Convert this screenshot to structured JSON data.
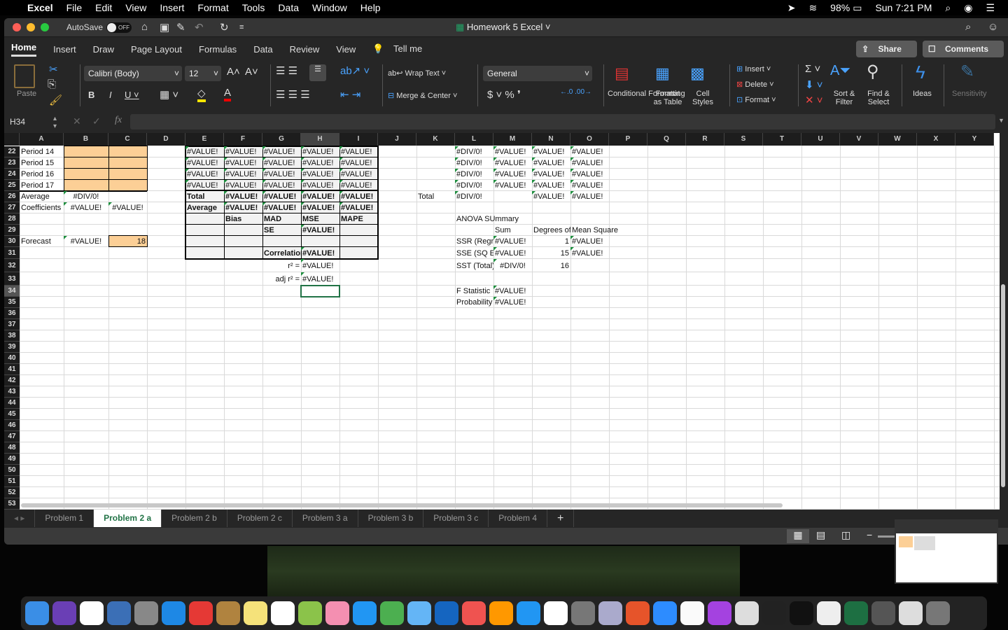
{
  "menubar": {
    "app": "Excel",
    "items": [
      "File",
      "Edit",
      "View",
      "Insert",
      "Format",
      "Tools",
      "Data",
      "Window",
      "Help"
    ],
    "battery": "98%",
    "clock": "Sun 7:21 PM"
  },
  "titlebar": {
    "autosave": "AutoSave",
    "autosave_state": "OFF",
    "title": "Homework 5 Excel"
  },
  "tabs": [
    "Home",
    "Insert",
    "Draw",
    "Page Layout",
    "Formulas",
    "Data",
    "Review",
    "View",
    "Tell me"
  ],
  "share": "Share",
  "comments": "Comments",
  "ribbon": {
    "paste": "Paste",
    "font": "Calibri (Body)",
    "size": "12",
    "wrap": "Wrap Text",
    "merge": "Merge & Center",
    "number_format": "General",
    "cond_fmt": "Conditional Formatting",
    "fmt_table": "Format as Table",
    "cell_styles": "Cell Styles",
    "insert": "Insert",
    "delete": "Delete",
    "format": "Format",
    "sort": "Sort & Filter",
    "find": "Find & Select",
    "ideas": "Ideas",
    "sensitivity": "Sensitivity"
  },
  "formula_bar": {
    "name_box": "H34",
    "fx": "fx",
    "value": ""
  },
  "grid": {
    "columns": [
      "A",
      "B",
      "C",
      "D",
      "E",
      "F",
      "G",
      "H",
      "I",
      "J",
      "K",
      "L",
      "M",
      "N",
      "O",
      "P",
      "Q",
      "R",
      "S",
      "T",
      "U",
      "V",
      "W",
      "X",
      "Y"
    ],
    "first_row": 22,
    "last_row": 53,
    "selected": "H34",
    "cells": [
      {
        "c": "A22",
        "v": "Period 14"
      },
      {
        "c": "A23",
        "v": "Period 15"
      },
      {
        "c": "A24",
        "v": "Period 16"
      },
      {
        "c": "A25",
        "v": "Period 17"
      },
      {
        "c": "A26",
        "v": "Average"
      },
      {
        "c": "B26",
        "v": "#DIV/0!",
        "a": "center",
        "f": 1
      },
      {
        "c": "A27",
        "v": "Coefficients"
      },
      {
        "c": "B27",
        "v": "#VALUE!",
        "a": "center",
        "f": 1
      },
      {
        "c": "C27",
        "v": "#VALUE!",
        "a": "center",
        "f": 1
      },
      {
        "c": "A30",
        "v": "Forecast"
      },
      {
        "c": "B30",
        "v": "#VALUE!",
        "a": "center",
        "f": 1
      },
      {
        "c": "C30",
        "v": "18",
        "a": "right"
      },
      {
        "c": "E22",
        "v": "#VALUE!",
        "f": 1
      },
      {
        "c": "F22",
        "v": "#VALUE!",
        "f": 1
      },
      {
        "c": "G22",
        "v": "#VALUE!",
        "f": 1
      },
      {
        "c": "H22",
        "v": "#VALUE!",
        "f": 1
      },
      {
        "c": "I22",
        "v": "#VALUE!",
        "f": 1
      },
      {
        "c": "E23",
        "v": "#VALUE!",
        "f": 1
      },
      {
        "c": "F23",
        "v": "#VALUE!",
        "f": 1
      },
      {
        "c": "G23",
        "v": "#VALUE!",
        "f": 1
      },
      {
        "c": "H23",
        "v": "#VALUE!",
        "f": 1
      },
      {
        "c": "I23",
        "v": "#VALUE!",
        "f": 1
      },
      {
        "c": "E24",
        "v": "#VALUE!",
        "f": 1
      },
      {
        "c": "F24",
        "v": "#VALUE!",
        "f": 1
      },
      {
        "c": "G24",
        "v": "#VALUE!",
        "f": 1
      },
      {
        "c": "H24",
        "v": "#VALUE!",
        "f": 1
      },
      {
        "c": "I24",
        "v": "#VALUE!",
        "f": 1
      },
      {
        "c": "E25",
        "v": "#VALUE!",
        "f": 1
      },
      {
        "c": "F25",
        "v": "#VALUE!",
        "f": 1
      },
      {
        "c": "G25",
        "v": "#VALUE!",
        "f": 1
      },
      {
        "c": "H25",
        "v": "#VALUE!",
        "f": 1
      },
      {
        "c": "I25",
        "v": "#VALUE!",
        "f": 1
      },
      {
        "c": "E26",
        "v": "Total",
        "b": 1
      },
      {
        "c": "F26",
        "v": "#VALUE!",
        "b": 1,
        "f": 1
      },
      {
        "c": "G26",
        "v": "#VALUE!",
        "b": 1,
        "f": 1
      },
      {
        "c": "H26",
        "v": "#VALUE!",
        "b": 1,
        "f": 1
      },
      {
        "c": "I26",
        "v": "#VALUE!",
        "b": 1,
        "f": 1
      },
      {
        "c": "E27",
        "v": "Average",
        "b": 1
      },
      {
        "c": "F27",
        "v": "#VALUE!",
        "b": 1,
        "f": 1
      },
      {
        "c": "G27",
        "v": "#VALUE!",
        "b": 1,
        "f": 1
      },
      {
        "c": "H27",
        "v": "#VALUE!",
        "b": 1,
        "f": 1
      },
      {
        "c": "I27",
        "v": "#VALUE!",
        "b": 1,
        "f": 1
      },
      {
        "c": "F28",
        "v": "Bias",
        "b": 1
      },
      {
        "c": "G28",
        "v": "MAD",
        "b": 1
      },
      {
        "c": "H28",
        "v": "MSE",
        "b": 1
      },
      {
        "c": "I28",
        "v": "MAPE",
        "b": 1
      },
      {
        "c": "G29",
        "v": "SE",
        "b": 1
      },
      {
        "c": "H29",
        "v": "#VALUE!",
        "b": 1,
        "f": 1
      },
      {
        "c": "G31",
        "v": "Correlation",
        "b": 1
      },
      {
        "c": "H31",
        "v": "#VALUE!",
        "b": 1,
        "f": 1
      },
      {
        "c": "G32",
        "v": "r² =",
        "a": "right"
      },
      {
        "c": "H32",
        "v": "#VALUE!",
        "f": 1
      },
      {
        "c": "G33",
        "v": "adj r² =",
        "a": "right"
      },
      {
        "c": "H33",
        "v": "#VALUE!",
        "f": 1
      },
      {
        "c": "K26",
        "v": "Total"
      },
      {
        "c": "L22",
        "v": "#DIV/0!",
        "f": 1
      },
      {
        "c": "M22",
        "v": "#VALUE!",
        "f": 1
      },
      {
        "c": "N22",
        "v": "#VALUE!",
        "f": 1
      },
      {
        "c": "O22",
        "v": "#VALUE!",
        "f": 1
      },
      {
        "c": "L23",
        "v": "#DIV/0!",
        "f": 1
      },
      {
        "c": "M23",
        "v": "#VALUE!",
        "f": 1
      },
      {
        "c": "N23",
        "v": "#VALUE!",
        "f": 1
      },
      {
        "c": "O23",
        "v": "#VALUE!",
        "f": 1
      },
      {
        "c": "L24",
        "v": "#DIV/0!",
        "f": 1
      },
      {
        "c": "M24",
        "v": "#VALUE!",
        "f": 1
      },
      {
        "c": "N24",
        "v": "#VALUE!",
        "f": 1
      },
      {
        "c": "O24",
        "v": "#VALUE!",
        "f": 1
      },
      {
        "c": "L25",
        "v": "#DIV/0!",
        "f": 1
      },
      {
        "c": "M25",
        "v": "#VALUE!",
        "f": 1
      },
      {
        "c": "N25",
        "v": "#VALUE!",
        "f": 1
      },
      {
        "c": "O25",
        "v": "#VALUE!",
        "f": 1
      },
      {
        "c": "L26",
        "v": "#DIV/0!",
        "f": 1
      },
      {
        "c": "N26",
        "v": "#VALUE!",
        "f": 1
      },
      {
        "c": "O26",
        "v": "#VALUE!",
        "f": 1
      },
      {
        "c": "L28",
        "v": "ANOVA SUmmary",
        "o": 1
      },
      {
        "c": "M29",
        "v": "Sum"
      },
      {
        "c": "N29",
        "v": "Degrees of"
      },
      {
        "c": "O29",
        "v": "Mean Square",
        "o": 1
      },
      {
        "c": "L30",
        "v": "SSR (Regre"
      },
      {
        "c": "M30",
        "v": "#VALUE!",
        "f": 1
      },
      {
        "c": "N30",
        "v": "1",
        "a": "right"
      },
      {
        "c": "O30",
        "v": "#VALUE!",
        "f": 1
      },
      {
        "c": "L31",
        "v": "SSE (SQ Er"
      },
      {
        "c": "M31",
        "v": "#VALUE!",
        "f": 1
      },
      {
        "c": "N31",
        "v": "15",
        "a": "right"
      },
      {
        "c": "O31",
        "v": "#VALUE!",
        "f": 1
      },
      {
        "c": "L32",
        "v": "SST (Total)"
      },
      {
        "c": "M32",
        "v": "#DIV/0!",
        "a": "center",
        "f": 1
      },
      {
        "c": "N32",
        "v": "16",
        "a": "right"
      },
      {
        "c": "L34",
        "v": "F Statistic"
      },
      {
        "c": "M34",
        "v": "#VALUE!",
        "f": 1
      },
      {
        "c": "L35",
        "v": "Probability"
      },
      {
        "c": "M35",
        "v": "#VALUE!",
        "f": 1
      }
    ]
  },
  "fills": {
    "orange": "#fccf96",
    "gray": "#f2f2f2",
    "selection": "#217346",
    "error_flag": "#1e8e3e"
  },
  "sheets": [
    "Problem 1",
    "Problem 2 a",
    "Problem 2 b",
    "Problem 2 c",
    "Problem 3 a",
    "Problem 3 b",
    "Problem 3 c",
    "Problem 4"
  ],
  "active_sheet": "Problem 2 a",
  "add_sheet": "+"
}
